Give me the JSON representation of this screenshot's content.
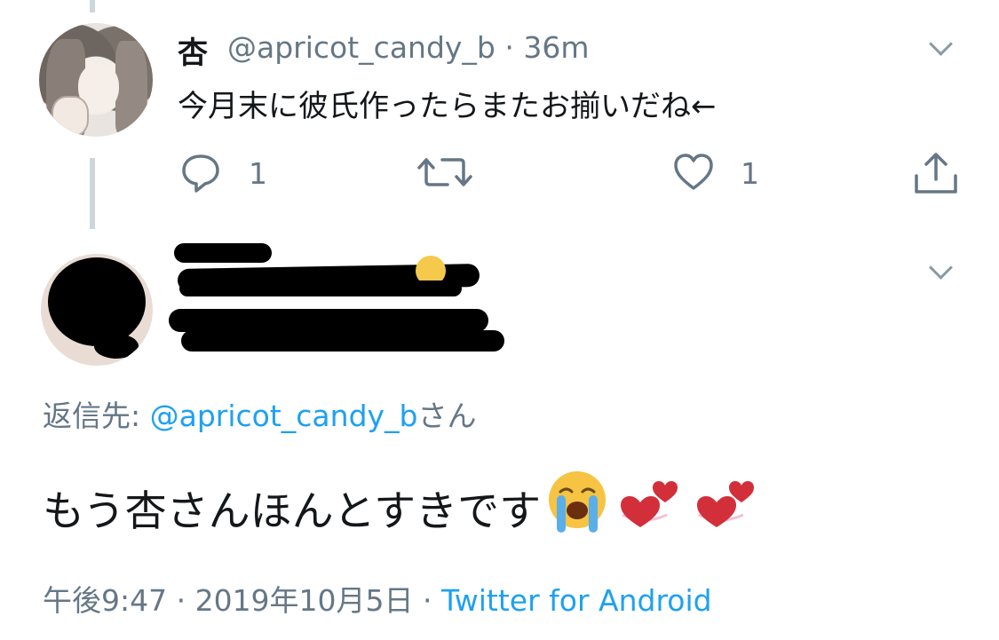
{
  "parent_tweet": {
    "display_name": "杏",
    "handle": "@apricot_candy_b",
    "separator": "·",
    "age": "36m",
    "text": "今月末に彼氏作ったらまたお揃いだね←",
    "reply_count": "1",
    "like_count": "1"
  },
  "reply_tweet": {
    "reply_to_prefix": "返信先: ",
    "reply_to_handle": "@apricot_candy_b",
    "reply_to_suffix": "さん",
    "text": "もう杏さんほんとすきです",
    "emojis": [
      "loudly-crying-face",
      "two-hearts",
      "two-hearts"
    ],
    "timestamp": "午後9:47 · 2019年10月5日",
    "meta_separator": "·",
    "source": "Twitter for Android"
  },
  "colors": {
    "text_primary": "#14171a",
    "text_secondary": "#657786",
    "link": "#1da1f2",
    "thread_line": "#ccd6dd"
  }
}
